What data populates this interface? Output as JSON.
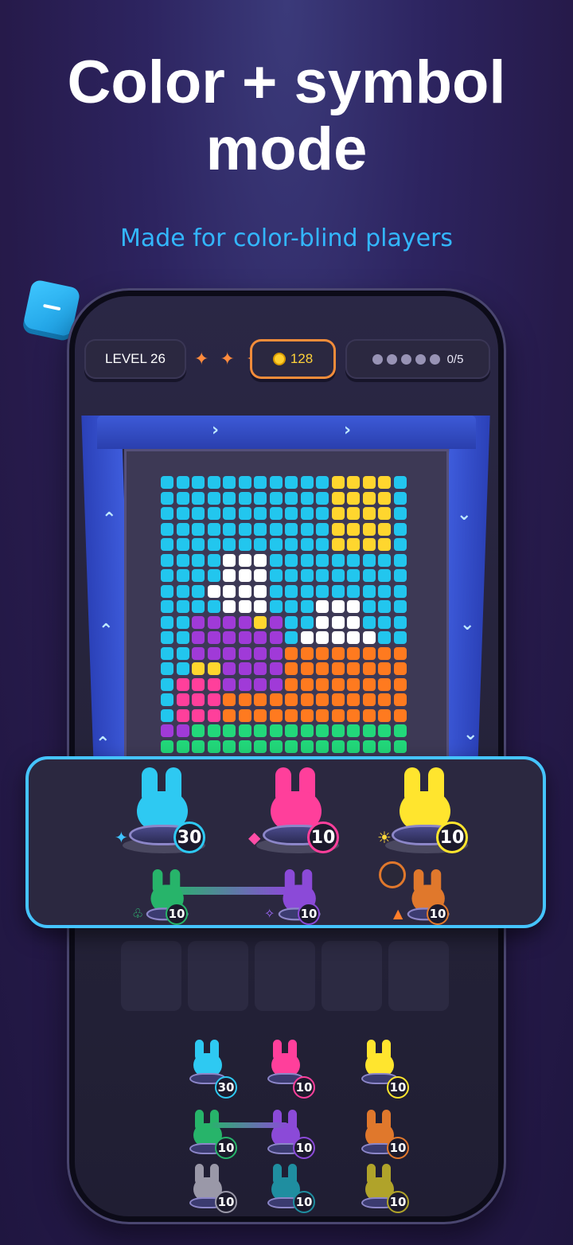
{
  "header": {
    "title_line1": "Color + symbol",
    "title_line2": "mode",
    "subtitle": "Made for color-blind players"
  },
  "hud": {
    "level_label": "LEVEL 26",
    "stars": "✦ ✦ ✦",
    "coins": "128",
    "progress_label": "0/5",
    "progress_dots": 5,
    "accent_color": "#f28c3a"
  },
  "tray": {
    "top_row": [
      {
        "color": "#2ec9f2",
        "count": "30",
        "symbol": "✦",
        "symbol_color": "#3fc3ff"
      },
      {
        "color": "#ff3f9b",
        "count": "10",
        "symbol": "◆",
        "symbol_color": "#ff4da6"
      },
      {
        "color": "#ffe52e",
        "count": "10",
        "symbol": "☀",
        "symbol_color": "#ffd83a"
      }
    ],
    "bottom_row": [
      {
        "color": "#27b46a",
        "count": "10",
        "symbol": "♧",
        "symbol_color": "#2ecf7a"
      },
      {
        "color": "#8b4ad8",
        "count": "10",
        "symbol": "✧",
        "symbol_color": "#a06aff"
      },
      {
        "color": "#e0782c",
        "count": "10",
        "symbol": "▲",
        "symbol_color": "#ff7d2a"
      }
    ]
  },
  "queue": {
    "row1": [
      {
        "color": "#2ec9f2",
        "count": "30"
      },
      {
        "color": "#ff3f9b",
        "count": "10"
      },
      {
        "color": "#ffe52e",
        "count": "10"
      }
    ],
    "row2": [
      {
        "color": "#27b46a",
        "count": "10"
      },
      {
        "color": "#8b4ad8",
        "count": "10"
      },
      {
        "color": "#e0782c",
        "count": "10"
      }
    ],
    "row3": [
      {
        "color": "#9a98a8",
        "count": "10"
      },
      {
        "color": "#1f8ea0",
        "count": "10"
      },
      {
        "color": "#b0a32a",
        "count": "10"
      }
    ]
  }
}
